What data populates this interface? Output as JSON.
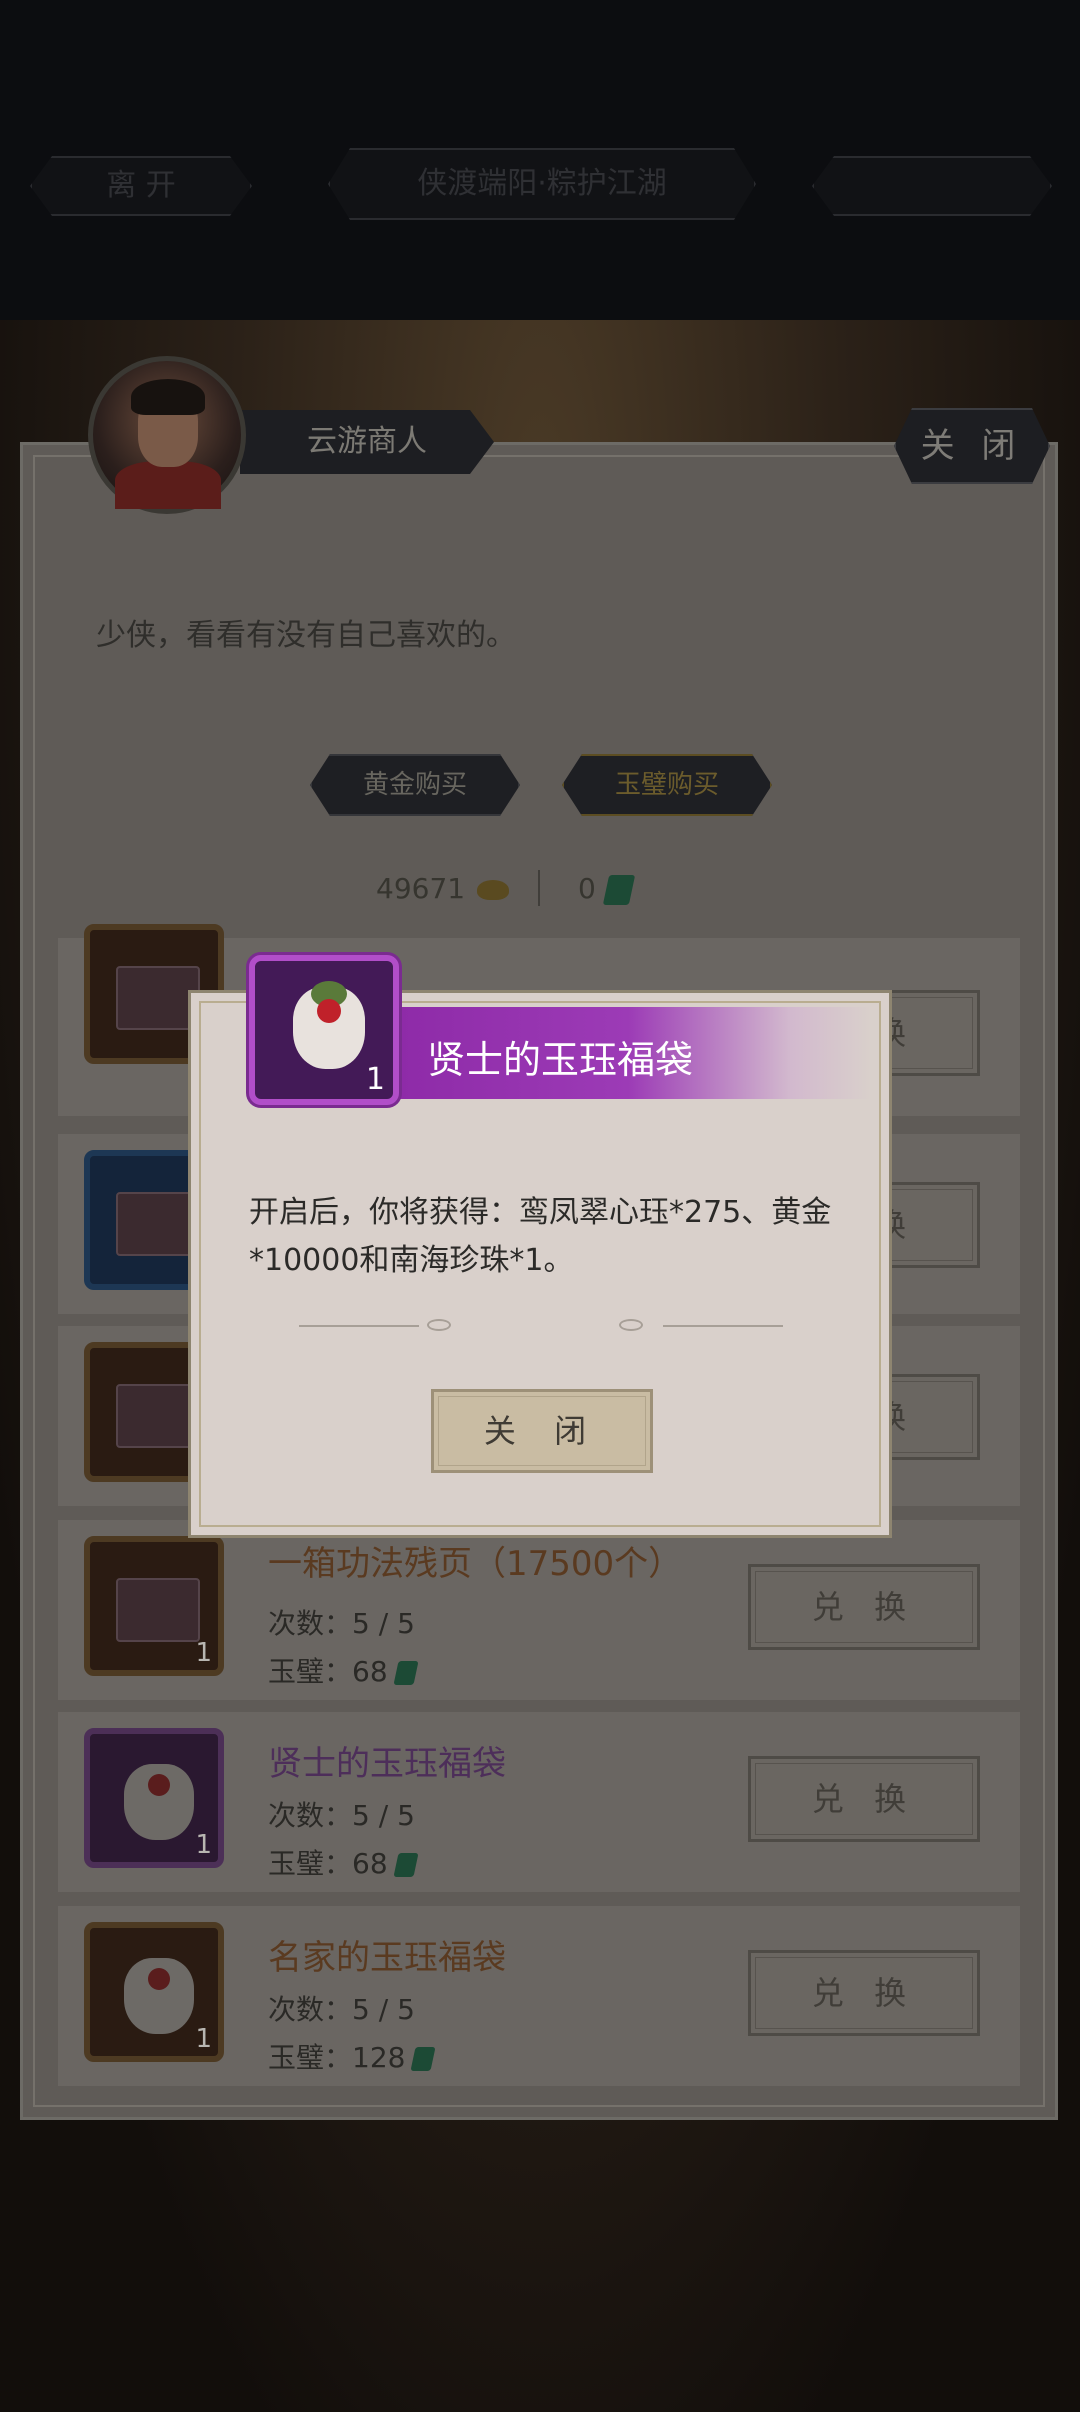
{
  "topbar": {
    "leave_label": "离 开",
    "event_label": "侠渡端阳·粽护江湖",
    "right_label": ""
  },
  "merchant": {
    "name": "云游商人",
    "close_label": "关 闭",
    "greeting": "少侠，看看有没有自己喜欢的。"
  },
  "tabs": [
    {
      "label": "黄金购买",
      "active": false
    },
    {
      "label": "玉璧购买",
      "active": true
    }
  ],
  "currency": {
    "gold": "49671",
    "jade": "0"
  },
  "items": [
    {
      "title": "",
      "type": "chest",
      "frame": "orange",
      "count": "",
      "button": "兑 换"
    },
    {
      "title": "",
      "type": "chest",
      "frame": "blue",
      "count": "",
      "button": "兑 换"
    },
    {
      "title": "",
      "type": "chest",
      "frame": "orange",
      "count": "",
      "button": "兑 换"
    },
    {
      "title": "一箱功法残页（17500个）",
      "type": "chest",
      "frame": "orange",
      "count": "1",
      "times_label": "次数：",
      "times": "5 / 5",
      "price_label": "玉璧：",
      "price": "68",
      "button": "兑 换"
    },
    {
      "title": "贤士的玉珏福袋",
      "type": "bag",
      "frame": "purple",
      "count": "1",
      "times_label": "次数：",
      "times": "5 / 5",
      "price_label": "玉璧：",
      "price": "68",
      "button": "兑 换"
    },
    {
      "title": "名家的玉珏福袋",
      "type": "bag",
      "frame": "orange",
      "count": "1",
      "times_label": "次数：",
      "times": "5 / 5",
      "price_label": "玉璧：",
      "price": "128",
      "button": "兑 换"
    }
  ],
  "modal": {
    "title": "贤士的玉珏福袋",
    "icon_count": "1",
    "description": "开启后，你将获得：鸾凤翠心珏*275、黄金*10000和南海珍珠*1。",
    "close_label": "关 闭",
    "header_color": "#8a26a4"
  }
}
